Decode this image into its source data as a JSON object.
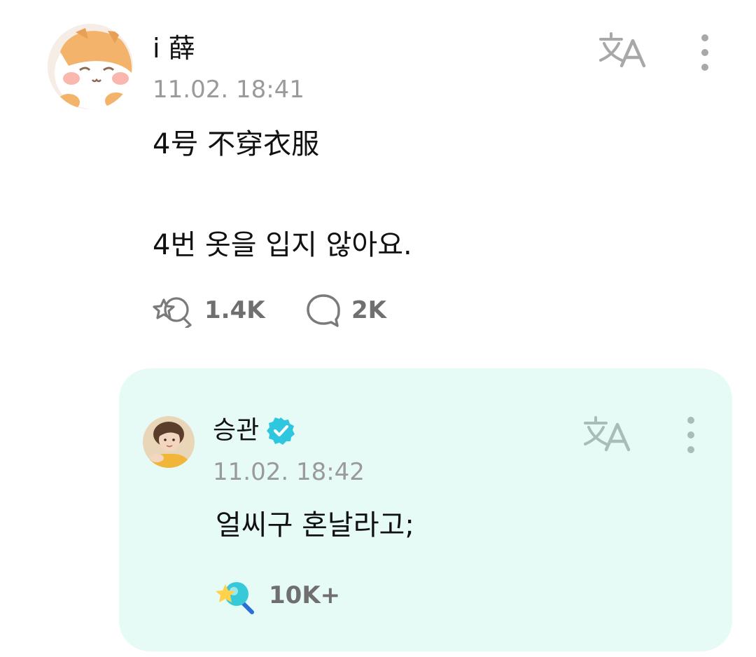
{
  "post": {
    "author": "i 薛",
    "timestamp": "11.02. 18:41",
    "lines": [
      "4号 不穿衣服",
      "4번 옷을 입지 않아요."
    ],
    "reaction_count": "1.4K",
    "comment_count": "2K",
    "avatar": "cat-avatar"
  },
  "reply": {
    "author": "승관",
    "verified": true,
    "timestamp": "11.02. 18:42",
    "text": "얼씨구 혼날라고;",
    "reaction_count": "10K+",
    "avatar": "person-avatar"
  },
  "icons": {
    "translate": "translate-icon",
    "more": "more-vertical-icon",
    "reaction": "reaction-icon",
    "comment": "comment-icon",
    "verified": "verified-badge-icon",
    "artist_reaction": "artist-reaction-icon"
  },
  "colors": {
    "reply_bg": "#e6fbf6",
    "accent": "#19c9c5",
    "meta_text": "#9a9a9a",
    "action_text": "#6f6f6f"
  }
}
